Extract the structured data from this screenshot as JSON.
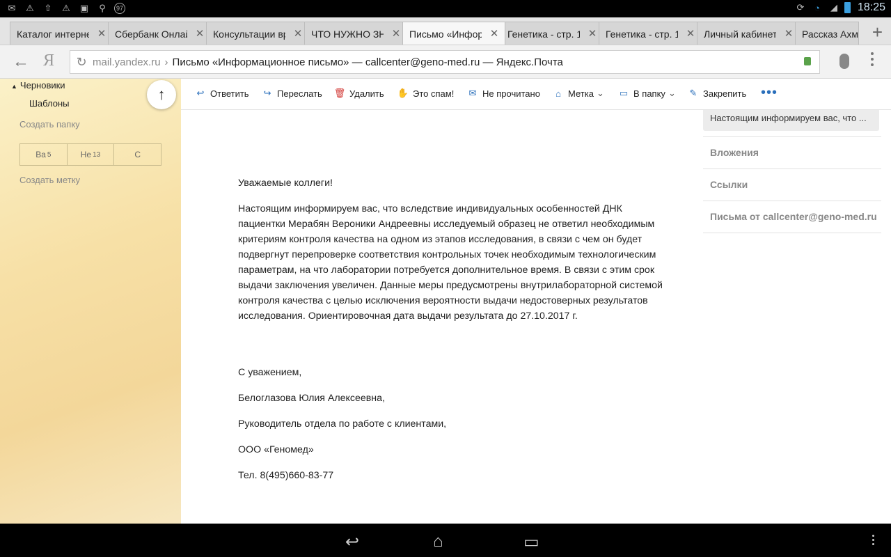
{
  "status": {
    "time": "18:25",
    "left_icons": [
      "mail-icon",
      "warning-icon",
      "upload-icon",
      "warning-icon",
      "app-icon",
      "search-icon",
      "badge-icon"
    ],
    "badge_text": "97"
  },
  "tabs": [
    {
      "title": "Каталог интерне",
      "active": false
    },
    {
      "title": "Сбербанк Онлай",
      "active": false
    },
    {
      "title": "Консультации вр",
      "active": false
    },
    {
      "title": "ЧТО НУЖНО ЗНА",
      "active": false
    },
    {
      "title": "Письмо «Инфор",
      "active": true
    },
    {
      "title": "Генетика - стр. 1",
      "active": false
    },
    {
      "title": "Генетика - стр. 1",
      "active": false
    },
    {
      "title": "Личный кабинет",
      "active": false
    },
    {
      "title": "Рассказ Ахм",
      "active": false
    }
  ],
  "address": {
    "host": "mail.yandex.ru",
    "separator": "›",
    "page_title": "Письмо «Информационное письмо» — callcenter@geno-med.ru — Яндекс.Почта"
  },
  "sidebar": {
    "drafts": "Черновики",
    "templates": "Шаблоны",
    "create_folder": "Создать папку",
    "segments": [
      {
        "label": "Ва",
        "count": "5"
      },
      {
        "label": "Не",
        "count": "13"
      },
      {
        "label": "С",
        "count": ""
      }
    ],
    "create_label": "Создать метку"
  },
  "toolbar": {
    "reply": "Ответить",
    "forward": "Переслать",
    "delete": "Удалить",
    "spam": "Это спам!",
    "unread": "Не прочитано",
    "label": "Метка",
    "to_folder": "В папку",
    "pin": "Закрепить",
    "more": "•••"
  },
  "letter": {
    "greeting": "Уважаемые коллеги!",
    "body": "Настоящим информируем вас, что вследствие индивидуальных особенностей ДНК пациентки Мерабян Вероники  Андреевны исследуемый образец не ответил необходимым критериям контроля качества на одном из этапов исследования, в связи с чем он будет подвергнут перепроверке соответствия контрольных точек необходимым технологическим параметрам, на что лаборатории потребуется дополнительное время. В связи с этим срок выдачи заключения увеличен. Данные меры предусмотрены внутрилабораторной системой контроля качества с целью исключения вероятности выдачи недостоверных результатов исследования. Ориентировочная дата выдачи результата до 27.10.2017 г.",
    "closing": "С уважением,",
    "name": "Белоглазова Юлия Алексеевна,",
    "position": "Руководитель отдела по работе с клиентами,",
    "company": "ООО «Геномед»",
    "phone": "Тел. 8(495)660-83-77"
  },
  "right_panel": {
    "snippet": "Настоящим информируем вас, что ...",
    "attachments": "Вложения",
    "links": "Ссылки",
    "letters_from": "Письма от callcenter@geno-med.ru"
  },
  "colors": {
    "accent": "#2a6fbb",
    "delete": "#d0312d",
    "spam": "#e6b800"
  }
}
